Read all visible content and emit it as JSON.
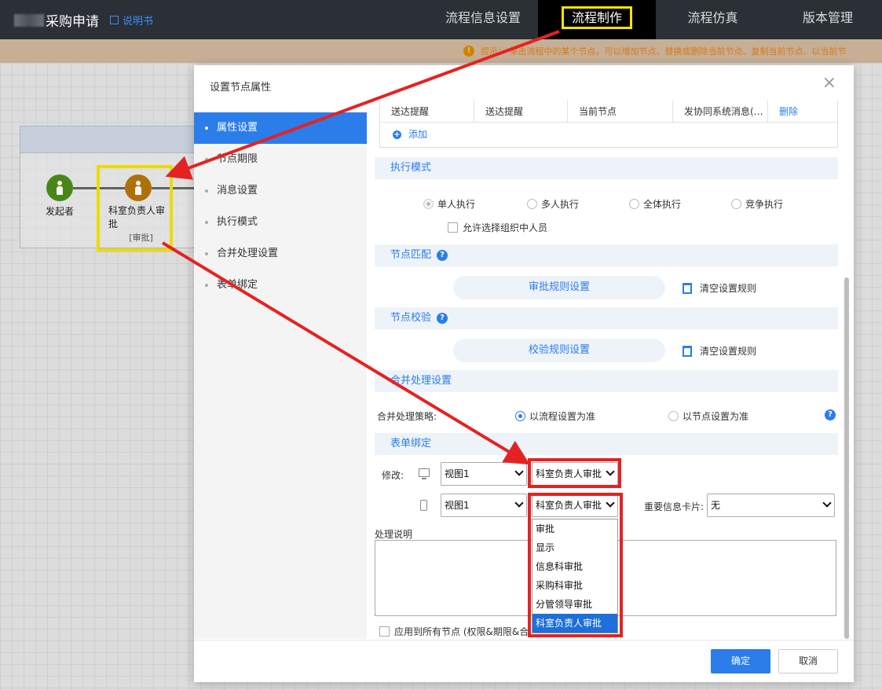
{
  "header": {
    "title": "采购申请",
    "manual_label": "说明书",
    "tabs": [
      {
        "label": "流程信息设置",
        "active": false
      },
      {
        "label": "流程制作",
        "active": true
      },
      {
        "label": "流程仿真",
        "active": false
      },
      {
        "label": "版本管理",
        "active": false
      }
    ]
  },
  "hint": {
    "text": "提示： 单击流程中的某个节点，可以增加节点、替换或删除当前节点、复制当前节点、以当前节"
  },
  "flow": {
    "nodes": [
      {
        "label": "发起者",
        "color": "#4c8c1a"
      },
      {
        "label": "科室负责人审批",
        "sub": "[审批]",
        "color": "#b5760c"
      }
    ]
  },
  "modal": {
    "title": "设置节点属性",
    "close_label": "×",
    "side_items": [
      {
        "label": "属性设置",
        "active": true
      },
      {
        "label": "节点期限",
        "active": false
      },
      {
        "label": "消息设置",
        "active": false
      },
      {
        "label": "执行模式",
        "active": false
      },
      {
        "label": "合并处理设置",
        "active": false
      },
      {
        "label": "表单绑定",
        "active": false
      }
    ],
    "table_row": [
      "送达提醒",
      "送达提醒",
      "当前节点",
      "发协同系统消息(…"
    ],
    "table_delete": "删除",
    "table_add": "添加",
    "exec_mode": {
      "title": "执行模式",
      "options": [
        "单人执行",
        "多人执行",
        "全体执行",
        "竞争执行"
      ],
      "selected": "单人执行",
      "allow_org": "允许选择组织中人员"
    },
    "node_match": {
      "title": "节点匹配",
      "button": "审批规则设置",
      "clear": "清空设置规则"
    },
    "node_check": {
      "title": "节点校验",
      "button": "校验规则设置",
      "clear": "清空设置规则"
    },
    "merge": {
      "title": "合并处理设置",
      "label": "合并处理策略:",
      "options": [
        "以流程设置为准",
        "以节点设置为准"
      ],
      "selected": "以流程设置为准"
    },
    "form_bind": {
      "title": "表单绑定",
      "modify_label": "修改:",
      "pc_view": "视图1",
      "pc_operation": "科室负责人审批",
      "mobile_view": "视图1",
      "mobile_operation": "科室负责人审批",
      "important_card_label": "重要信息卡片:",
      "important_card_value": "无",
      "dropdown_options": [
        "审批",
        "显示",
        "信息科审批",
        "采购科审批",
        "分管领导审批",
        "科室负责人审批"
      ],
      "dropdown_selected": "科室负责人审批"
    },
    "process_note_label": "处理说明",
    "apply_all": "应用到所有节点 (权限&期限&合",
    "ok": "确定",
    "cancel": "取消"
  },
  "colors": {
    "accent": "#2b7de9",
    "header_bg": "#2b2f36",
    "annotation_yellow": "#f5e400",
    "annotation_red": "#e52222"
  }
}
